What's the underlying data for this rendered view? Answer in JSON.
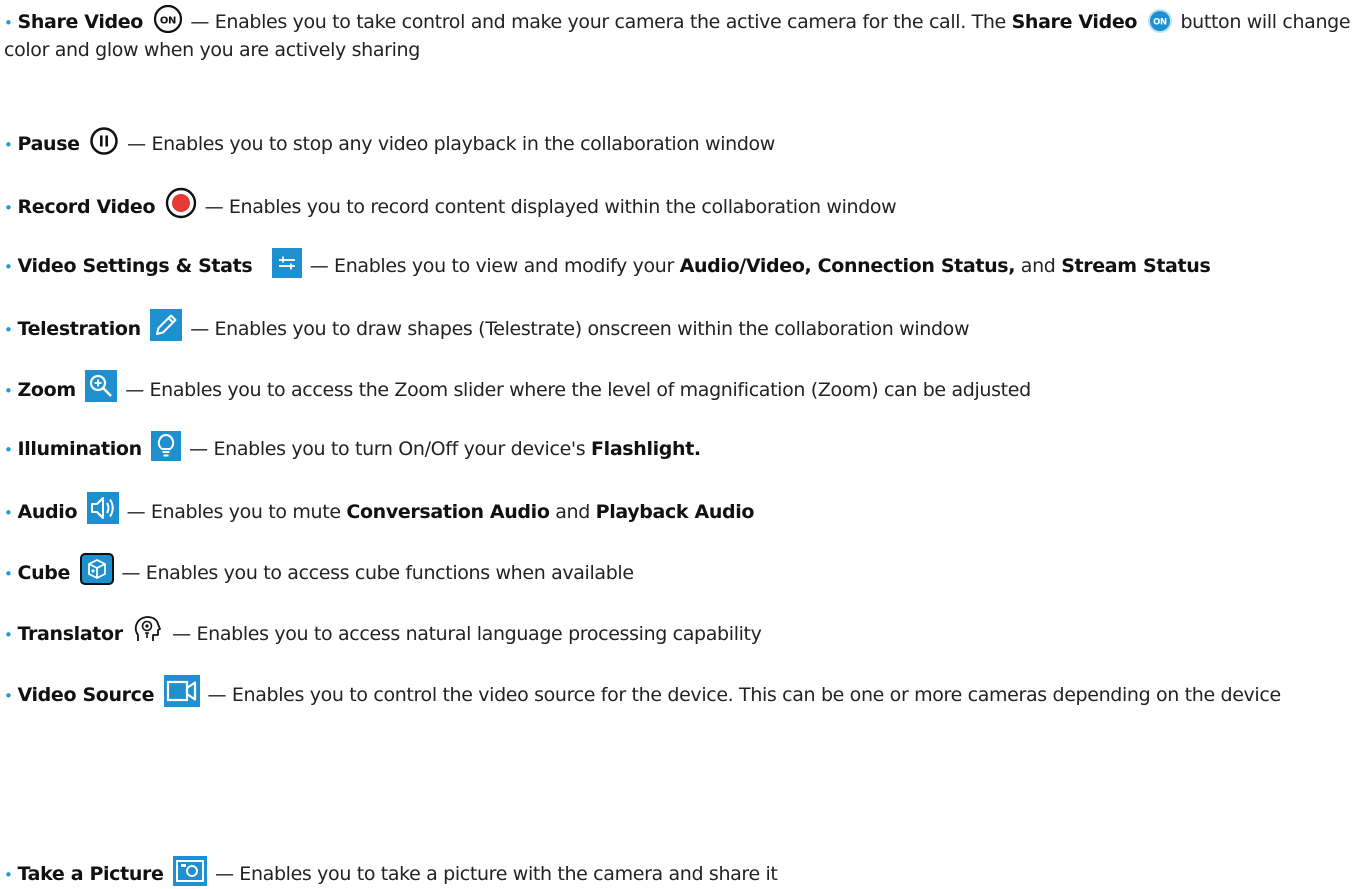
{
  "bullet": "•",
  "items": [
    {
      "icon": "share-video-on-icon",
      "title": "Share Video",
      "desc": "— Enables you to take control and make your camera the active camera for the call. The ",
      "bold2": "Share Video",
      "desc2": " button will change color and glow when you are actively sharing",
      "badge_icon": "on-badge-blue-icon",
      "badge_text": "ON",
      "icon_text": "ON"
    },
    {
      "icon": "pause-icon",
      "title": "Pause",
      "desc": "— Enables you to stop any video playback in the collaboration window"
    },
    {
      "icon": "record-icon",
      "title": "Record Video",
      "desc": "— Enables you to record content displayed within the collaboration window"
    },
    {
      "icon": "settings-sliders-icon",
      "title": "Video Settings & Stats",
      "desc": "— Enables you to view and modify your ",
      "bold2": "Audio/Video, Connection Status,",
      "desc2": " and ",
      "bold3": "Stream Status"
    },
    {
      "icon": "pencil-icon",
      "title": "Telestration",
      "desc": "— Enables you to draw shapes (Telestrate) onscreen within the collaboration window"
    },
    {
      "icon": "zoom-in-icon",
      "title": "Zoom",
      "desc": "— Enables you to access the Zoom slider where the level of magnification (Zoom) can be adjusted"
    },
    {
      "icon": "lightbulb-icon",
      "title": "Illumination",
      "desc": "— Enables you to turn On/Off your device's ",
      "bold2": "Flashlight."
    },
    {
      "icon": "speaker-icon",
      "title": "Audio",
      "desc": "— Enables you to mute ",
      "bold2": "Conversation Audio",
      "desc2": " and ",
      "bold3": "Playback Audio"
    },
    {
      "icon": "cube-icon",
      "title": "Cube",
      "desc": "— Enables you to access cube functions when available"
    },
    {
      "icon": "translator-icon",
      "title": "Translator",
      "desc": "— Enables you to access natural language processing capability"
    },
    {
      "icon": "video-camera-icon",
      "title": "Video Source",
      "desc": "— Enables you to control the video source for the device. This can be one or more cameras depending on the device"
    },
    {
      "icon": "camera-photo-icon",
      "title": "Take a Picture",
      "desc": "— Enables you to take a picture with the camera and share it"
    }
  ],
  "colors": {
    "bullet": "#1d9bd8",
    "icon_blue": "#1e90d0",
    "record_red": "#e53935",
    "text": "#222222"
  }
}
